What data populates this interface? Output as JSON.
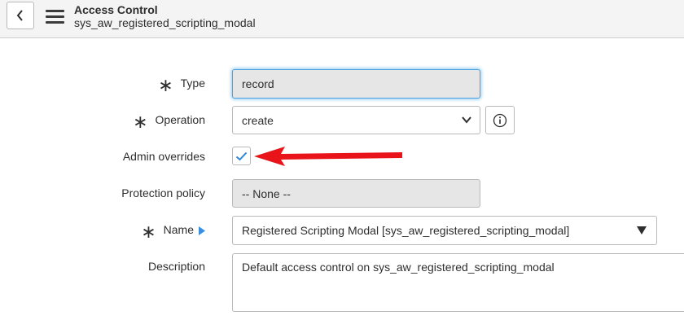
{
  "header": {
    "title": "Access Control",
    "subtitle": "sys_aw_registered_scripting_modal"
  },
  "form": {
    "type": {
      "label": "Type",
      "value": "record",
      "required": true
    },
    "operation": {
      "label": "Operation",
      "value": "create",
      "required": true
    },
    "admin_overrides": {
      "label": "Admin overrides",
      "checked": true
    },
    "protection_policy": {
      "label": "Protection policy",
      "value": "-- None --"
    },
    "name": {
      "label": "Name",
      "value": "Registered Scripting Modal [sys_aw_registered_scripting_modal]",
      "required": true
    },
    "description": {
      "label": "Description",
      "value": "Default access control on sys_aw_registered_scripting_modal"
    }
  },
  "colors": {
    "accent": "#4aa3e0",
    "check": "#2e86d8",
    "annotation_arrow": "#e8141a"
  },
  "icons": {
    "back": "chevron-left-icon",
    "menu": "hamburger-menu-icon",
    "info": "info-icon",
    "reference": "triangle-right-icon"
  }
}
